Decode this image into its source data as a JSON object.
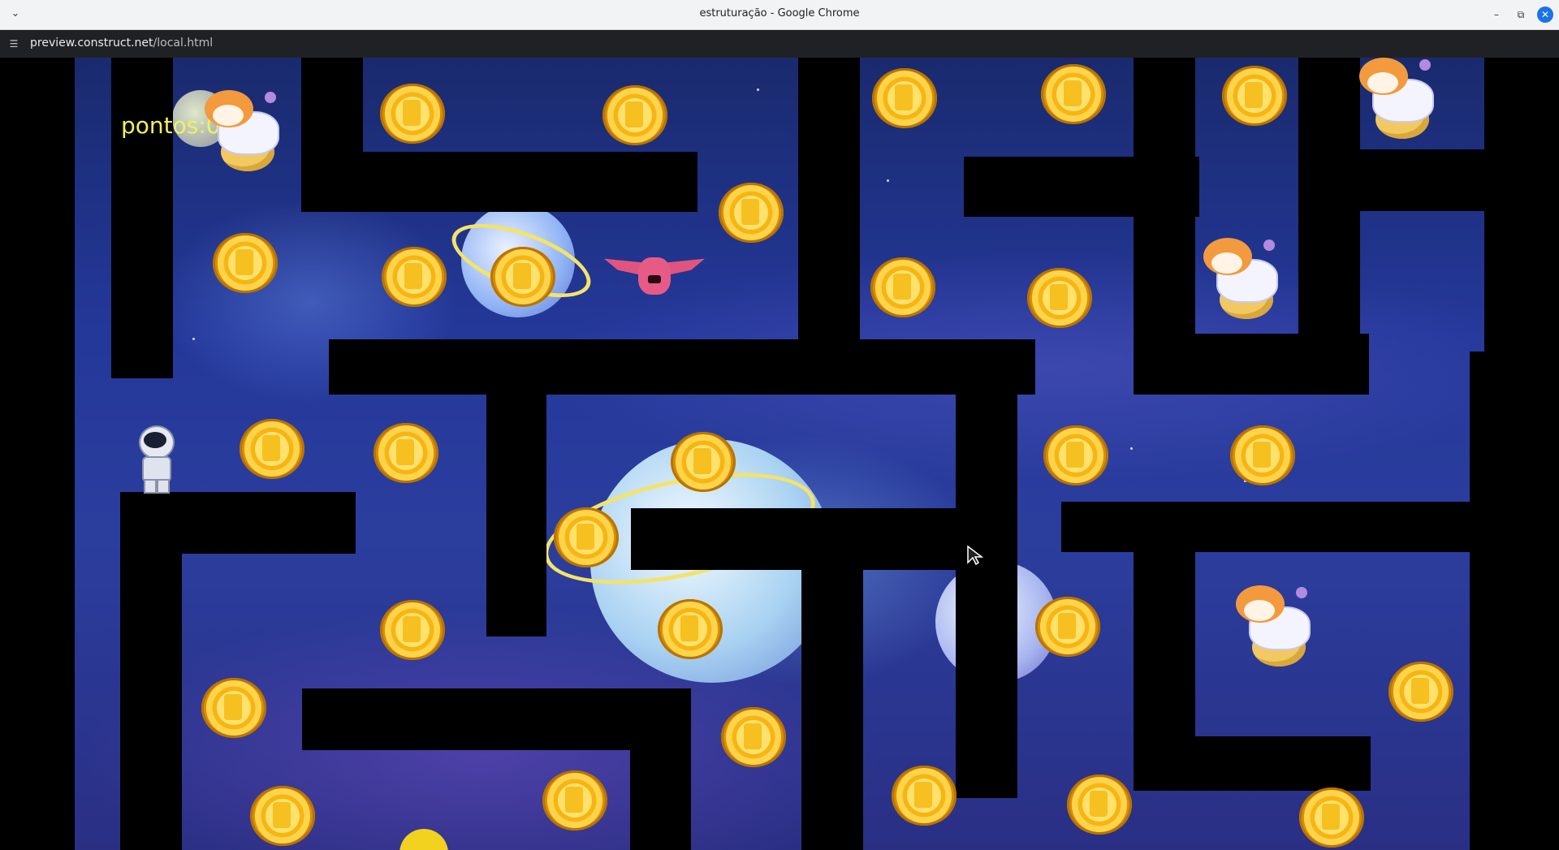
{
  "browser": {
    "window_title": "estruturação - Google Chrome",
    "url_host": "preview.construct.net",
    "url_path": "/local.html",
    "tab_menu_icon": "chevron-down-icon",
    "site_info_icon": "tune-icon",
    "controls": {
      "minimize": "–",
      "maximize": "⧉",
      "close": "✕"
    }
  },
  "game": {
    "score_label": "pontos:0",
    "colors": {
      "wall": "#000000",
      "score": "#f0f060",
      "coin": "#f5b514",
      "background": "#24389a"
    }
  }
}
